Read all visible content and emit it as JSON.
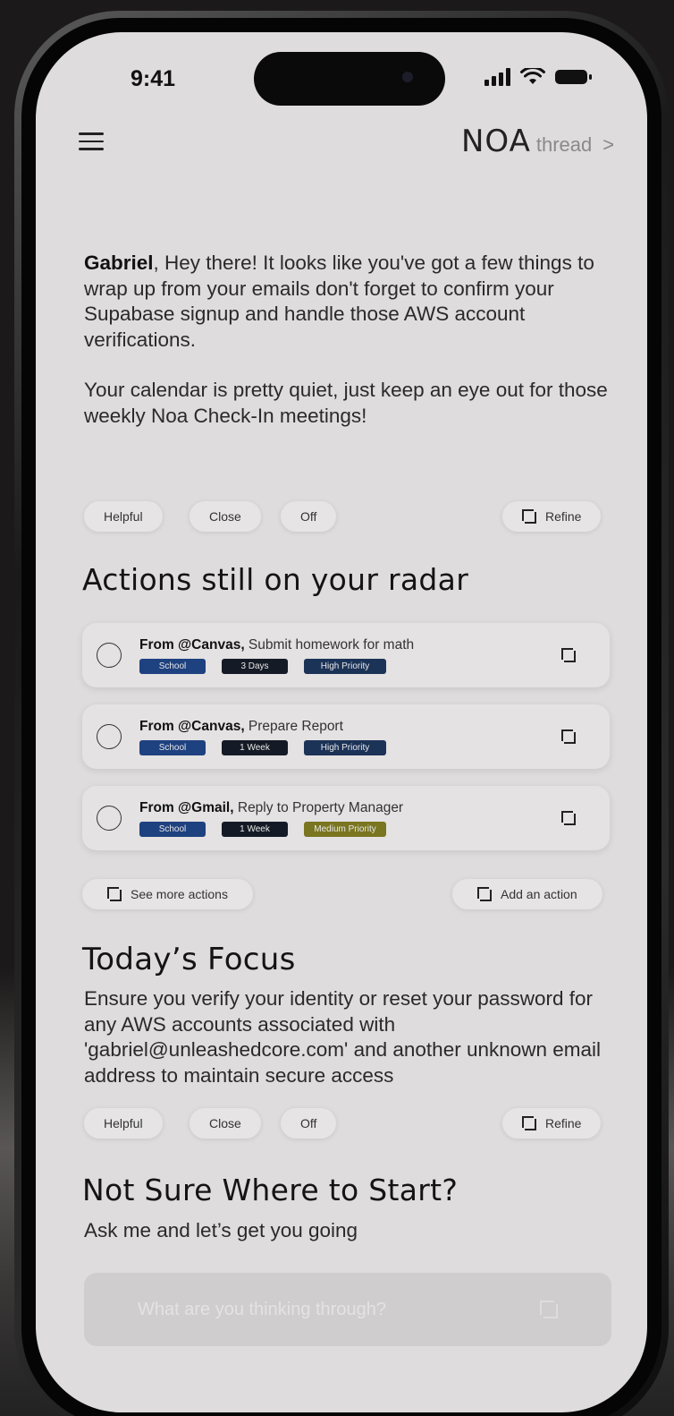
{
  "status": {
    "time": "9:41"
  },
  "brand": {
    "logo": "NOA",
    "sub": "thread",
    "chevron": ">"
  },
  "intro": {
    "name": "Gabriel",
    "message": ", Hey there! It looks like you've got a few things to wrap up from your emails don't forget to confirm your Supabase signup and handle those AWS account verifications.",
    "calendar": "Your calendar is pretty quiet, just keep an eye out for those weekly Noa Check-In meetings!"
  },
  "feedback": {
    "helpful": "Helpful",
    "close": "Close",
    "off": "Off",
    "refine": "Refine"
  },
  "actions": {
    "title": "Actions still on your radar",
    "items": [
      {
        "source": "From @Canvas,",
        "task": " Submit homework for math",
        "tags": [
          "School",
          "3 Days",
          "High Priority"
        ]
      },
      {
        "source": "From @Canvas,",
        "task": " Prepare Report",
        "tags": [
          "School",
          "1 Week",
          "High Priority"
        ]
      },
      {
        "source": "From @Gmail,",
        "task": " Reply to Property Manager",
        "tags": [
          "School",
          "1 Week",
          "Medium Priority"
        ]
      }
    ],
    "see_more": "See more actions",
    "add": "Add an action"
  },
  "focus": {
    "title": "Today’s Focus",
    "text": "Ensure you verify your identity or reset your password for any AWS accounts associated with 'gabriel@unleashedcore.com' and another unknown email address to maintain secure access"
  },
  "start": {
    "title": "Not Sure Where to Start?",
    "subtitle": "Ask me and let’s get you going",
    "placeholder": "What are you thinking through?"
  },
  "colors": {
    "school_tag": "#1e4180",
    "duration_tag": "#151b26",
    "high_priority_tag": "#1c3358",
    "medium_priority_tag": "#7a7520",
    "screen_bg": "#dedcdc"
  }
}
